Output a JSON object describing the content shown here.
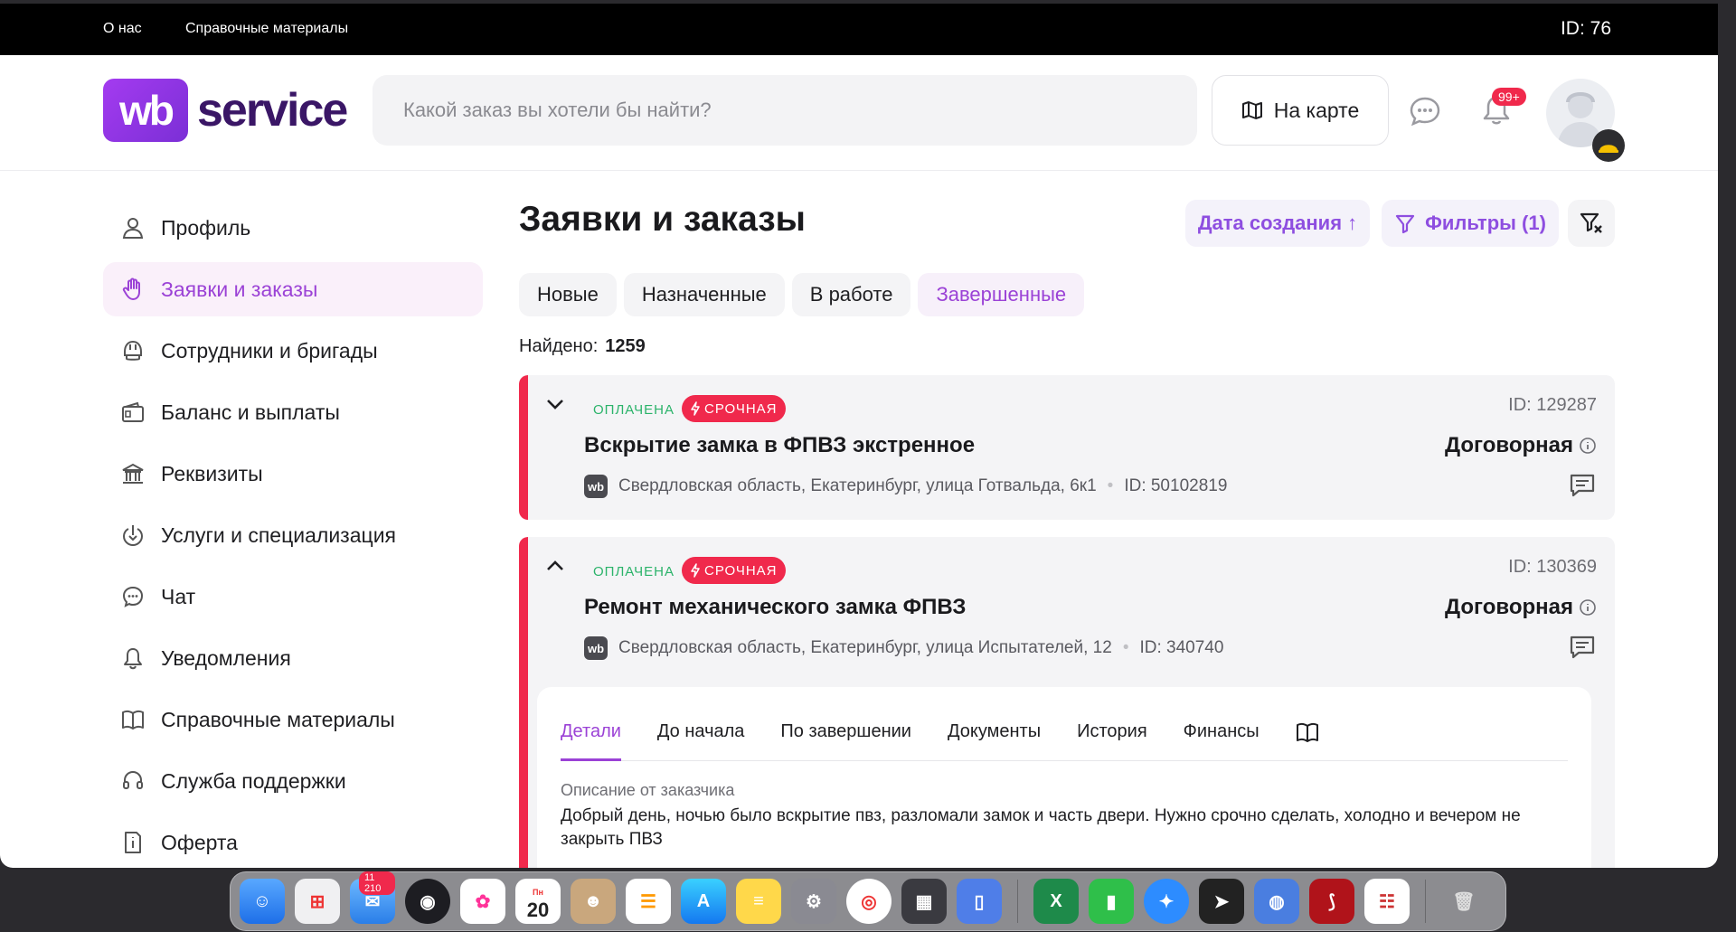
{
  "topbar": {
    "about": "О нас",
    "reference": "Справочные материалы",
    "user_id": "ID: 76"
  },
  "header": {
    "logo_badge": "wb",
    "logo_text": "service",
    "search_placeholder": "Какой заказ вы хотели бы найти?",
    "map_button": "На карте",
    "notifications_badge": "99+"
  },
  "sidebar": {
    "items": [
      {
        "label": "Профиль",
        "icon": "user-icon"
      },
      {
        "label": "Заявки и заказы",
        "icon": "hand-icon",
        "active": true
      },
      {
        "label": "Сотрудники и бригады",
        "icon": "helmet-icon"
      },
      {
        "label": "Баланс и выплаты",
        "icon": "wallet-icon"
      },
      {
        "label": "Реквизиты",
        "icon": "bank-icon"
      },
      {
        "label": "Услуги и специализация",
        "icon": "services-icon"
      },
      {
        "label": "Чат",
        "icon": "chat-icon"
      },
      {
        "label": "Уведомления",
        "icon": "bell-icon"
      },
      {
        "label": "Справочные материалы",
        "icon": "book-icon"
      },
      {
        "label": "Служба поддержки",
        "icon": "headset-icon"
      },
      {
        "label": "Оферта",
        "icon": "document-icon"
      }
    ]
  },
  "main": {
    "title": "Заявки и заказы",
    "sort_label": "Дата создания ↑",
    "filters_label": "Фильтры (1)",
    "tabs": [
      {
        "label": "Новые"
      },
      {
        "label": "Назначенные"
      },
      {
        "label": "В работе"
      },
      {
        "label": "Завершенные",
        "active": true
      }
    ],
    "found_label": "Найдено:",
    "found_count": "1259",
    "orders": [
      {
        "status": "ОПЛАЧЕНА",
        "urgency": "СРОЧНАЯ",
        "id": "ID: 129287",
        "title": "Вскрытие замка в ФПВЗ экстренное",
        "price": "Договорная",
        "address": "Свердловская область, Екатеринбург, улица Готвальда, 6к1",
        "point_id": "ID: 50102819",
        "expanded": false
      },
      {
        "status": "ОПЛАЧЕНА",
        "urgency": "СРОЧНАЯ",
        "id": "ID: 130369",
        "title": "Ремонт механического замка ФПВЗ",
        "price": "Договорная",
        "address": "Свердловская область, Екатеринбург, улица Испытателей, 12",
        "point_id": "ID: 340740",
        "expanded": true
      }
    ],
    "details": {
      "tabs": [
        "Детали",
        "До начала",
        "По завершении",
        "Документы",
        "История",
        "Финансы"
      ],
      "active_tab": "Детали",
      "description_label": "Описание от заказчика",
      "description_text": "Добрый день, ночью было вскрытие пвз, разломали замок и часть двери. Нужно срочно сделать, холодно и вечером не закрыть ПВЗ"
    }
  },
  "dock": {
    "mail_badge": "11 210",
    "calendar_day": "20",
    "calendar_weekday": "Пн"
  },
  "colors": {
    "accent": "#9b42d6",
    "urgent": "#f0294c",
    "paid": "#2bb36a"
  }
}
